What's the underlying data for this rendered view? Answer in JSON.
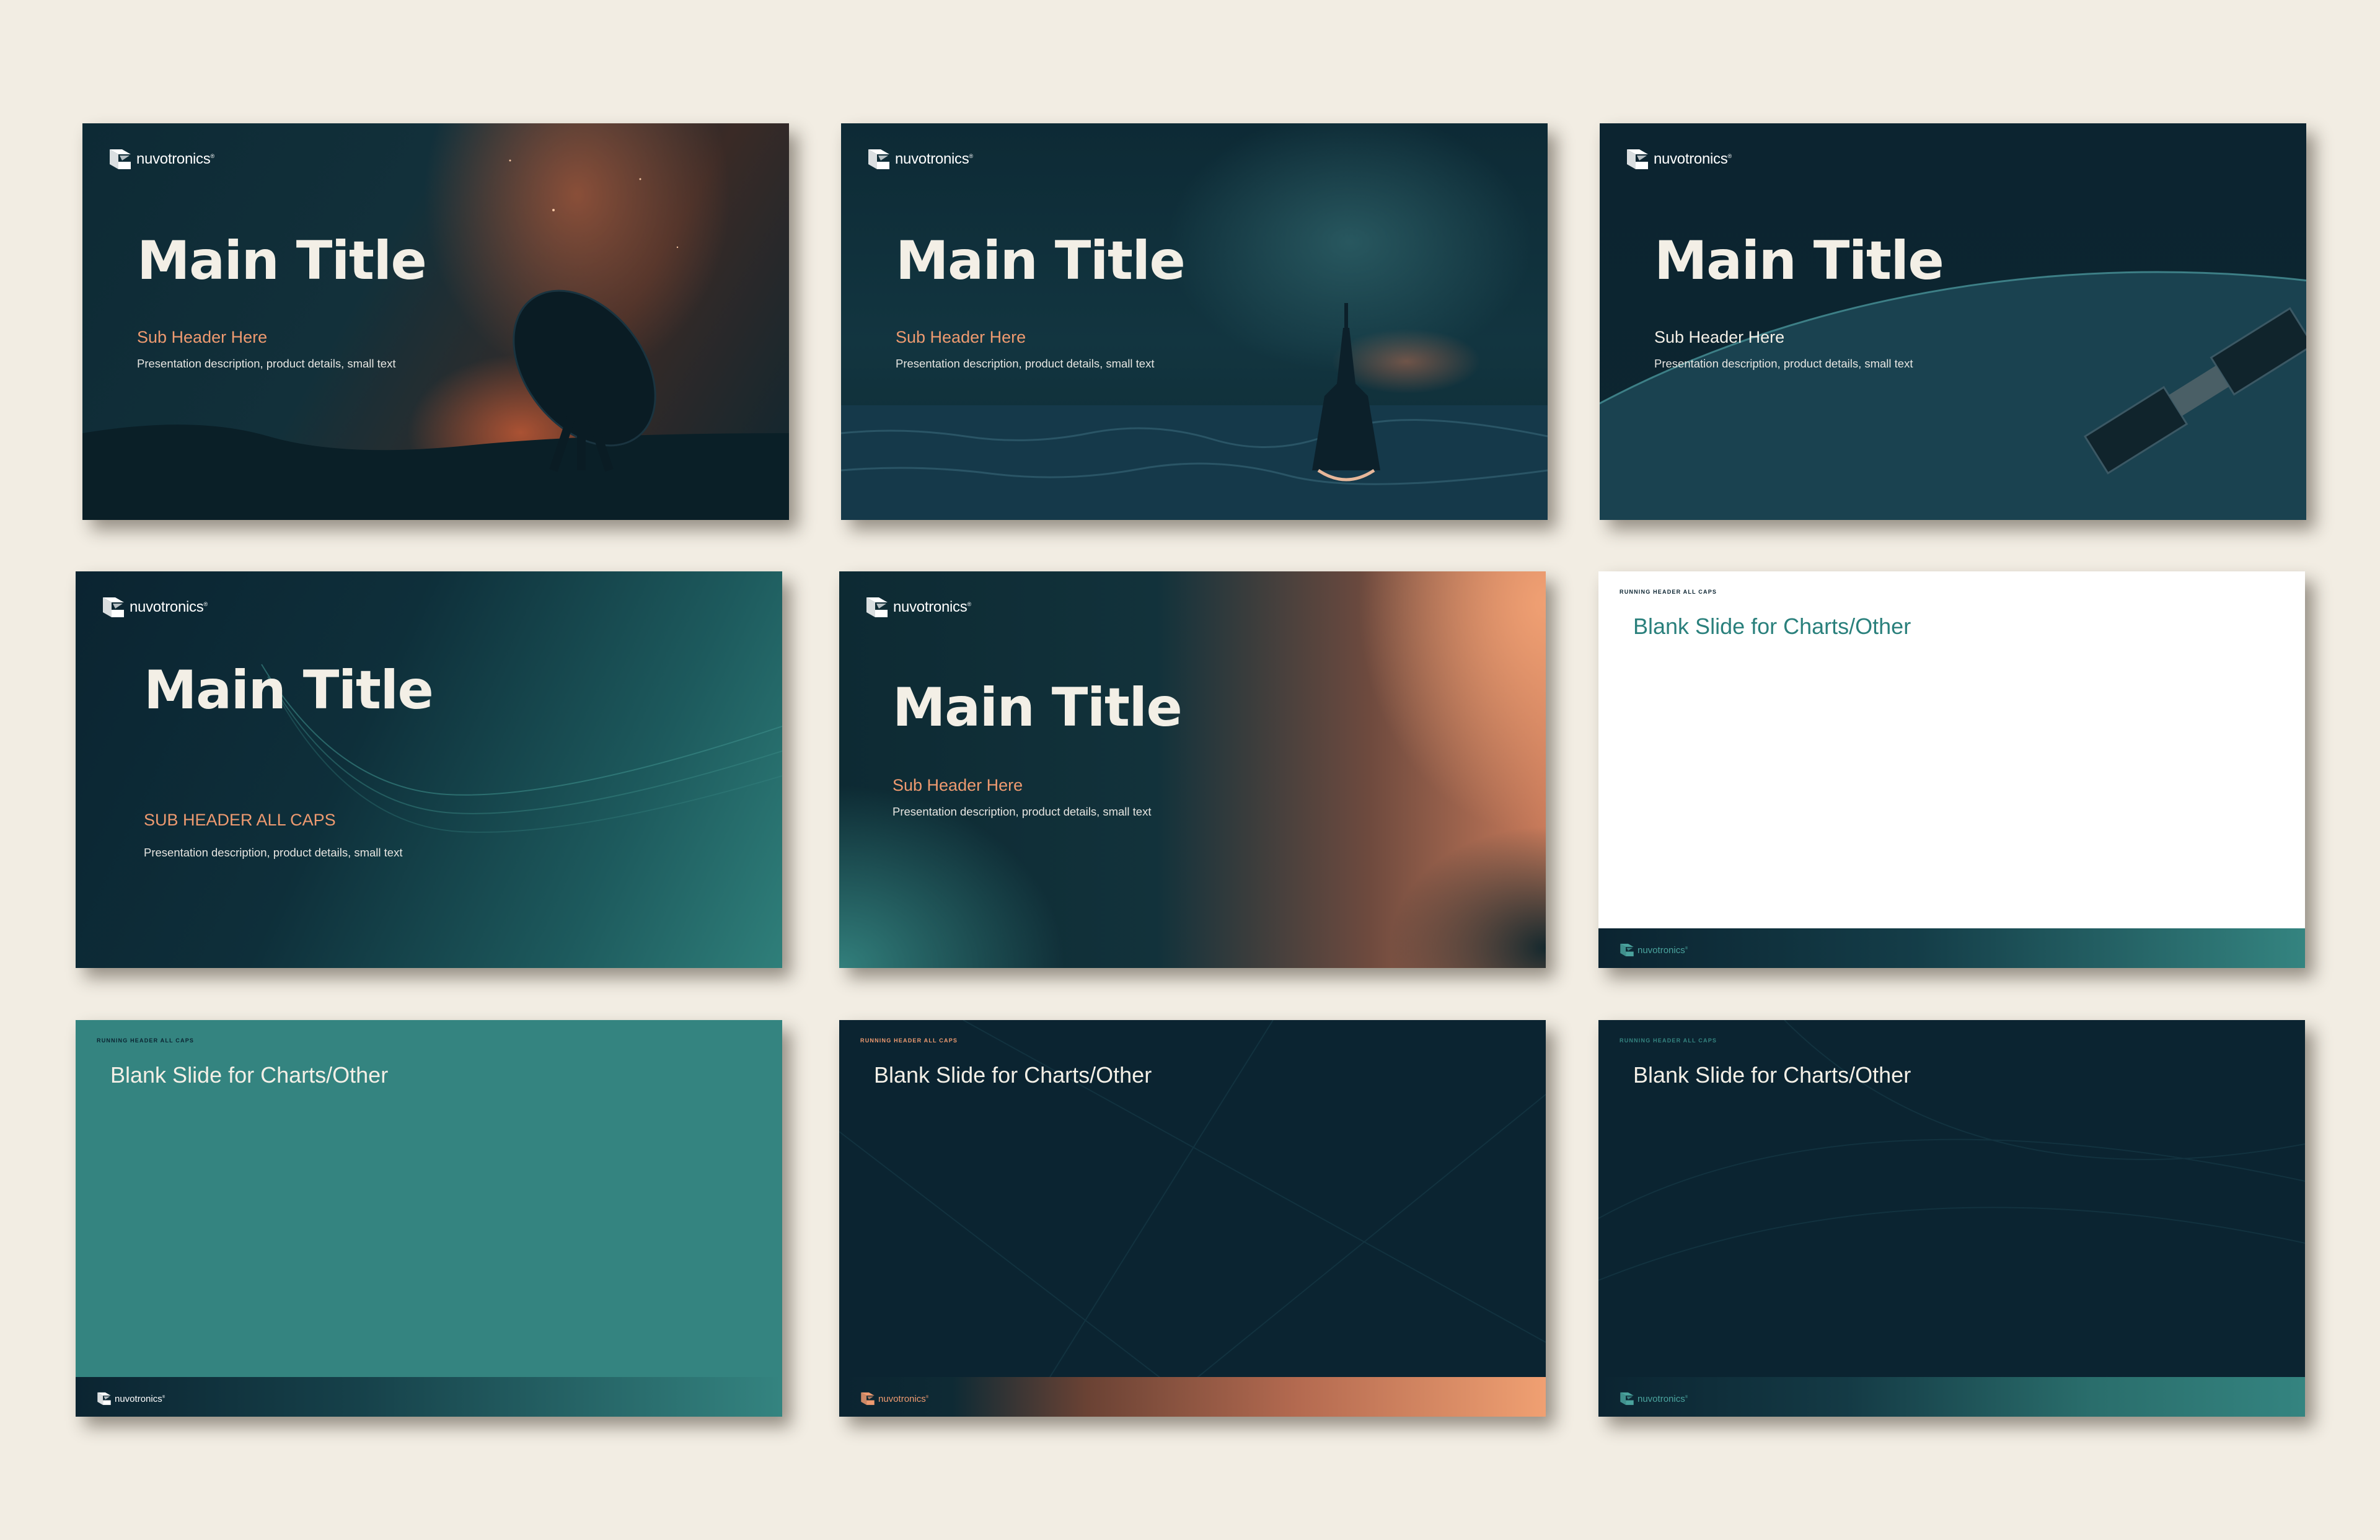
{
  "brand": "nuvotronics",
  "brand_mark": "®",
  "colors": {
    "background": "#f2ede3",
    "navy": "#0b2431",
    "teal": "#348480",
    "orange": "#ee9a70"
  },
  "slides": [
    {
      "kind": "title",
      "title": "Main Title",
      "sub": "Sub Header Here",
      "desc": "Presentation description, product details, small text",
      "image": "radio-telescope-milky-way"
    },
    {
      "kind": "title",
      "title": "Main Title",
      "sub": "Sub Header Here",
      "desc": "Presentation description, product details, small text",
      "image": "warship-at-sea"
    },
    {
      "kind": "title",
      "title": "Main Title",
      "sub": "Sub Header Here",
      "desc": "Presentation description, product details, small text",
      "image": "satellite-over-earth"
    },
    {
      "kind": "title",
      "title": "Main Title",
      "sub": "SUB HEADER ALL CAPS",
      "desc": "Presentation description, product details, small text",
      "image": "teal-wave-gradient"
    },
    {
      "kind": "title",
      "title": "Main Title",
      "sub": "Sub Header Here",
      "desc": "Presentation description, product details, small text",
      "image": "orange-teal-gradient"
    },
    {
      "kind": "blank",
      "running_header": "RUNNING HEADER ALL CAPS",
      "title": "Blank Slide for Charts/Other"
    },
    {
      "kind": "blank",
      "running_header": "RUNNING HEADER ALL CAPS",
      "title": "Blank Slide for Charts/Other"
    },
    {
      "kind": "blank",
      "running_header": "RUNNING HEADER ALL CAPS",
      "title": "Blank Slide for Charts/Other"
    },
    {
      "kind": "blank",
      "running_header": "RUNNING HEADER ALL CAPS",
      "title": "Blank Slide for Charts/Other"
    }
  ]
}
